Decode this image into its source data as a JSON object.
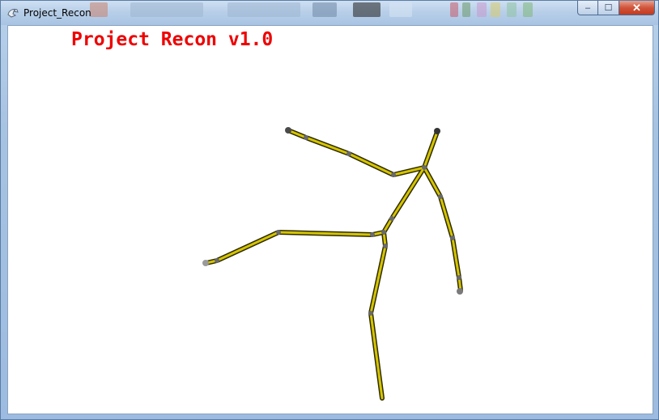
{
  "window": {
    "title": "Project_Recon",
    "controls": {
      "minimize_glyph": "–",
      "maximize_glyph": "☐",
      "close_glyph": "✕"
    }
  },
  "viewport": {
    "overlay_title": "Project Recon v1.0",
    "colors": {
      "overlay_text": "#ee0000",
      "skeleton_fill": "#d4c400",
      "skeleton_outline": "#2e2a00",
      "joint": "#5a5a5a",
      "background": "#ffffff"
    }
  }
}
